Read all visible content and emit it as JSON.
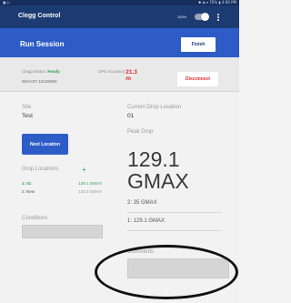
{
  "status_bar": {
    "left_text": "▣ ▷",
    "right_text": "✱ ◈ ▾ 70% ▮ 4:09 PM"
  },
  "app_bar": {
    "title": "Clegg Control",
    "battery_label": "100%",
    "toggle_on": true
  },
  "session": {
    "title": "Run Session",
    "finish_label": "Finish"
  },
  "device": {
    "status_label": "Clegg Status:",
    "status_value": "Ready",
    "device_id": "96CHST 18248900",
    "gps_label": "GPS Accuracy:",
    "gps_value": "21.3 m",
    "disconnect_label": "Disconnect"
  },
  "site": {
    "label": "Site",
    "value": "Test",
    "next_location_label": "Next Location"
  },
  "drop_locations": {
    "label": "Drop Locations",
    "add_icon": "+",
    "rows": [
      {
        "name": "1: 01",
        "reading": "129.1 GMAX"
      },
      {
        "name": "2: New",
        "reading": "132.9 GMAX"
      }
    ]
  },
  "conditions": {
    "label": "Conditions"
  },
  "current_drop": {
    "label": "Current Drop Location",
    "value": "01",
    "peak_label": "Peak Drop",
    "peak_value": "129.1",
    "peak_unit": "GMAX",
    "readings": [
      "2: 35 GMAX",
      "1: 129.1 GMAX"
    ]
  },
  "comments": {
    "label": "Comments"
  },
  "colors": {
    "app_bar": "#1d3b73",
    "title_bar": "#2e5cc7",
    "ready": "#27a34a",
    "alert": "#e0262b"
  }
}
